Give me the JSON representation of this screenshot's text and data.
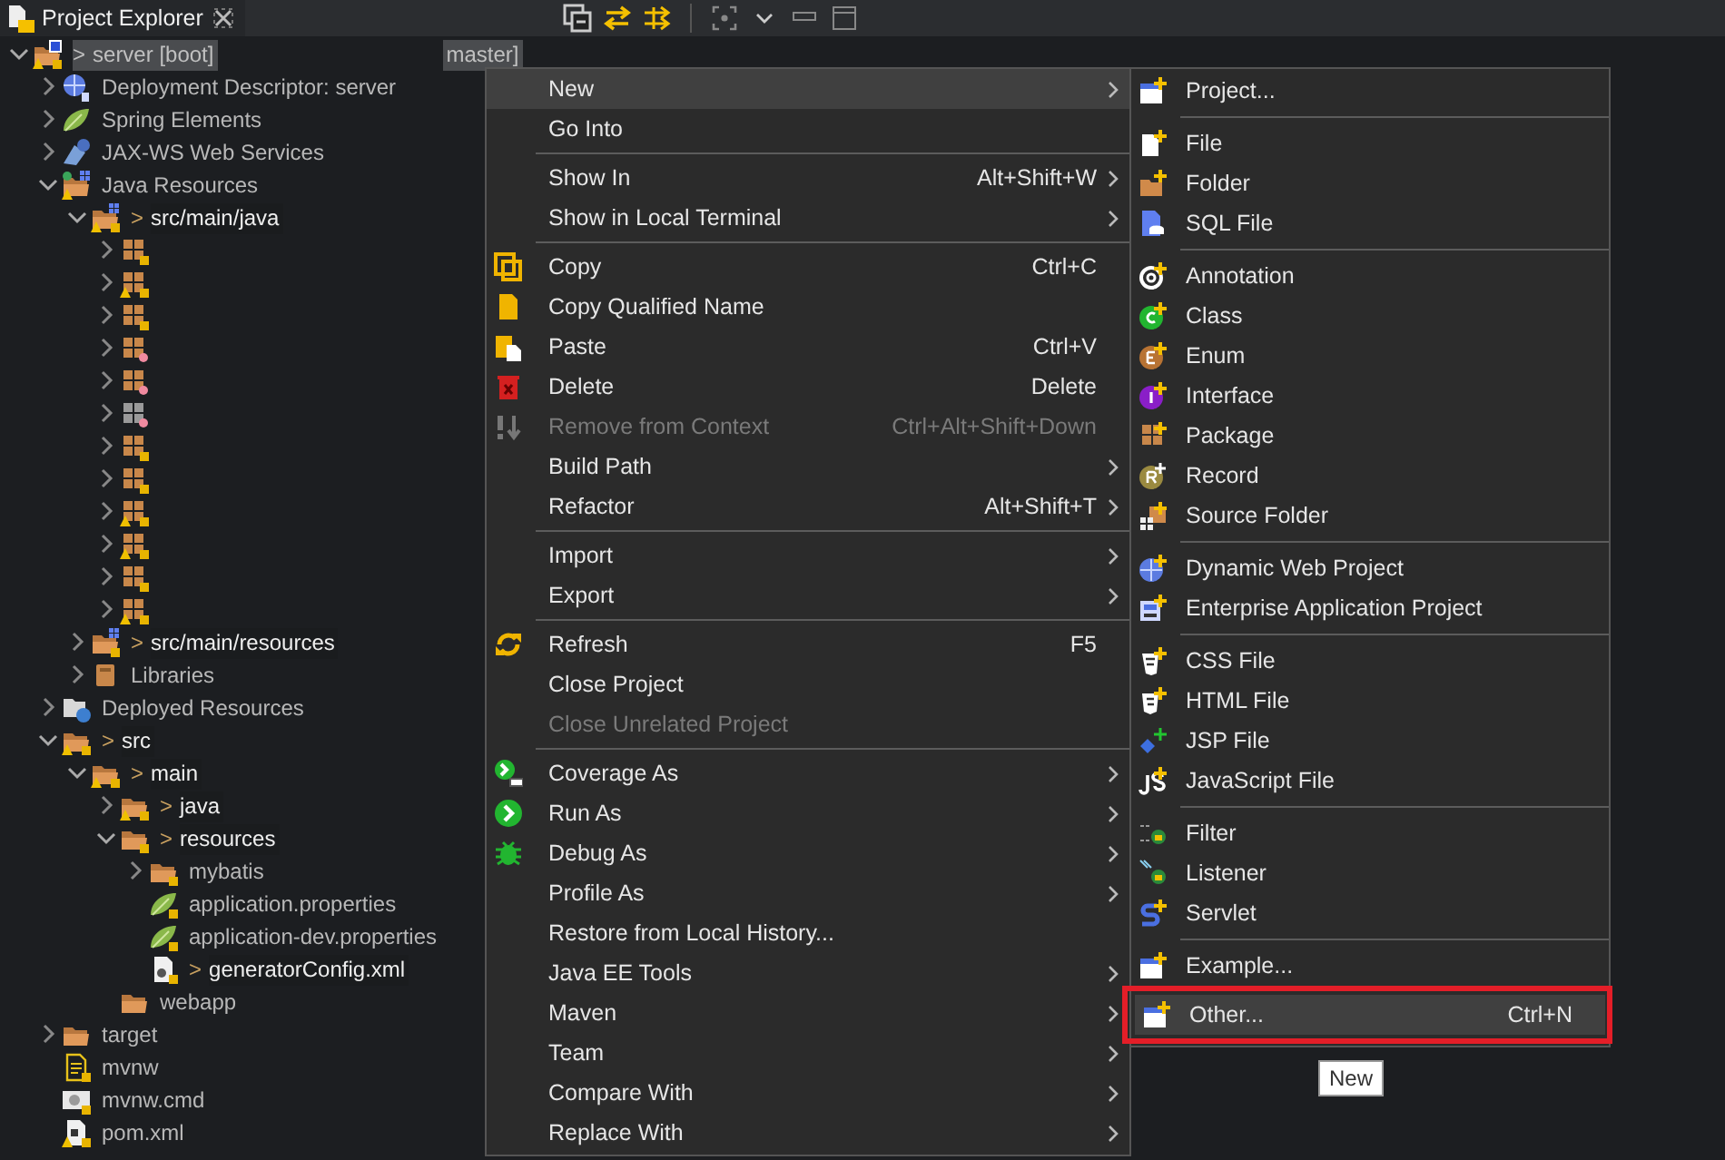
{
  "tab": {
    "title": "Project Explorer"
  },
  "tree": [
    {
      "label": "server [boot]",
      "prefix": ">",
      "tail": "master]",
      "kind": "project",
      "warning": true,
      "selected": true,
      "expanded": true,
      "children": [
        {
          "label": "Deployment Descriptor: server",
          "kind": "descriptor",
          "warning": false,
          "selected": false,
          "expanded": false
        },
        {
          "label": "Spring Elements",
          "kind": "spring",
          "warning": false,
          "selected": false,
          "expanded": false
        },
        {
          "label": "JAX-WS Web Services",
          "kind": "webservices",
          "warning": false,
          "selected": false,
          "expanded": false
        },
        {
          "label": "Java Resources",
          "kind": "java-resources",
          "warning": true,
          "selected": false,
          "expanded": true,
          "children": [
            {
              "label": "src/main/java",
              "prefix": ">",
              "kind": "source-folder",
              "warning": true,
              "selected": false,
              "expanded": true,
              "children": [
                {
                  "kind": "package",
                  "warning": false,
                  "selected": false,
                  "expanded": false
                },
                {
                  "kind": "package",
                  "warning": true,
                  "selected": false,
                  "expanded": false
                },
                {
                  "kind": "package",
                  "warning": false,
                  "selected": false,
                  "expanded": false
                },
                {
                  "kind": "package-q",
                  "warning": false,
                  "selected": false,
                  "expanded": false
                },
                {
                  "kind": "package-q",
                  "warning": false,
                  "selected": false,
                  "expanded": false
                },
                {
                  "kind": "package-grey",
                  "warning": false,
                  "selected": false,
                  "expanded": false
                },
                {
                  "kind": "package",
                  "warning": false,
                  "selected": false,
                  "expanded": false
                },
                {
                  "kind": "package",
                  "warning": false,
                  "selected": false,
                  "expanded": false
                },
                {
                  "kind": "package",
                  "warning": true,
                  "selected": false,
                  "expanded": false
                },
                {
                  "kind": "package",
                  "warning": true,
                  "selected": false,
                  "expanded": false
                },
                {
                  "kind": "package",
                  "warning": false,
                  "selected": false,
                  "expanded": false
                },
                {
                  "kind": "package",
                  "warning": true,
                  "selected": false,
                  "expanded": false
                }
              ]
            },
            {
              "label": "src/main/resources",
              "prefix": ">",
              "kind": "source-folder",
              "warning": false,
              "selected": false,
              "expanded": false
            },
            {
              "label": "Libraries",
              "kind": "libraries",
              "warning": false,
              "selected": false,
              "expanded": false
            }
          ]
        },
        {
          "label": "Deployed Resources",
          "kind": "deployed",
          "warning": false,
          "selected": false,
          "expanded": false
        },
        {
          "label": "src",
          "prefix": ">",
          "kind": "boot-folder",
          "warning": true,
          "selected": false,
          "expanded": true,
          "children": [
            {
              "label": "main",
              "prefix": ">",
              "kind": "boot-folder",
              "warning": true,
              "selected": false,
              "expanded": true,
              "children": [
                {
                  "label": "java",
                  "prefix": ">",
                  "kind": "boot-folder",
                  "warning": true,
                  "selected": false,
                  "expanded": false
                },
                {
                  "label": "resources",
                  "prefix": ">",
                  "kind": "boot-folder",
                  "warning": false,
                  "selected": false,
                  "expanded": true,
                  "children": [
                    {
                      "label": "mybatis",
                      "kind": "boot-folder",
                      "warning": false,
                      "selected": false,
                      "expanded": false
                    },
                    {
                      "label": "application.properties",
                      "kind": "props",
                      "warning": false,
                      "selected": false
                    },
                    {
                      "label": "application-dev.properties",
                      "kind": "props",
                      "warning": false,
                      "selected": false
                    },
                    {
                      "label": "generatorConfig.xml",
                      "prefix": ">",
                      "kind": "xml",
                      "warning": false,
                      "selected": false
                    }
                  ]
                },
                {
                  "label": "webapp",
                  "kind": "folder",
                  "warning": false,
                  "selected": false
                }
              ]
            }
          ]
        },
        {
          "label": "target",
          "kind": "folder",
          "warning": false,
          "selected": false,
          "expanded": false
        },
        {
          "label": "mvnw",
          "kind": "text-file",
          "warning": false,
          "selected": false
        },
        {
          "label": "mvnw.cmd",
          "kind": "cmd",
          "warning": false,
          "selected": false
        },
        {
          "label": "pom.xml",
          "kind": "pom",
          "warning": true,
          "selected": false
        }
      ]
    }
  ],
  "context_menu": {
    "items": [
      {
        "label": "New",
        "kind": "plain",
        "has_submenu": true,
        "disabled": false,
        "selected": true
      },
      {
        "label": "Go Into",
        "kind": "plain",
        "has_submenu": false,
        "disabled": false,
        "selected": false
      },
      {
        "kind": "separator"
      },
      {
        "label": "Show In",
        "shortcut": "Alt+Shift+W",
        "kind": "plain",
        "has_submenu": true,
        "disabled": false,
        "selected": false
      },
      {
        "label": "Show in Local Terminal",
        "kind": "plain",
        "has_submenu": true,
        "disabled": false,
        "selected": false
      },
      {
        "kind": "separator"
      },
      {
        "label": "Copy",
        "shortcut": "Ctrl+C",
        "kind": "copy",
        "has_submenu": false,
        "disabled": false,
        "selected": false
      },
      {
        "label": "Copy Qualified Name",
        "kind": "copy-name",
        "has_submenu": false,
        "disabled": false,
        "selected": false
      },
      {
        "label": "Paste",
        "shortcut": "Ctrl+V",
        "kind": "paste",
        "has_submenu": false,
        "disabled": false,
        "selected": false
      },
      {
        "label": "Delete",
        "shortcut": "Delete",
        "kind": "delete",
        "has_submenu": false,
        "disabled": false,
        "selected": false
      },
      {
        "label": "Remove from Context",
        "shortcut": "Ctrl+Alt+Shift+Down",
        "kind": "remove",
        "has_submenu": false,
        "disabled": true,
        "selected": false
      },
      {
        "label": "Build Path",
        "kind": "plain",
        "has_submenu": true,
        "disabled": false,
        "selected": false
      },
      {
        "label": "Refactor",
        "shortcut": "Alt+Shift+T",
        "kind": "plain",
        "has_submenu": true,
        "disabled": false,
        "selected": false
      },
      {
        "kind": "separator"
      },
      {
        "label": "Import",
        "kind": "plain",
        "has_submenu": true,
        "disabled": false,
        "selected": false
      },
      {
        "label": "Export",
        "kind": "plain",
        "has_submenu": true,
        "disabled": false,
        "selected": false
      },
      {
        "kind": "separator"
      },
      {
        "label": "Refresh",
        "shortcut": "F5",
        "kind": "refresh",
        "has_submenu": false,
        "disabled": false,
        "selected": false
      },
      {
        "label": "Close Project",
        "kind": "plain",
        "has_submenu": false,
        "disabled": false,
        "selected": false
      },
      {
        "label": "Close Unrelated Project",
        "kind": "plain",
        "has_submenu": false,
        "disabled": true,
        "selected": false
      },
      {
        "kind": "separator"
      },
      {
        "label": "Coverage As",
        "kind": "coverage",
        "has_submenu": true,
        "disabled": false,
        "selected": false
      },
      {
        "label": "Run As",
        "kind": "run",
        "has_submenu": true,
        "disabled": false,
        "selected": false
      },
      {
        "label": "Debug As",
        "kind": "debug",
        "has_submenu": true,
        "disabled": false,
        "selected": false
      },
      {
        "label": "Profile As",
        "kind": "plain",
        "has_submenu": true,
        "disabled": false,
        "selected": false
      },
      {
        "label": "Restore from Local History...",
        "kind": "plain",
        "has_submenu": false,
        "disabled": false,
        "selected": false
      },
      {
        "label": "Java EE Tools",
        "kind": "plain",
        "has_submenu": true,
        "disabled": false,
        "selected": false
      },
      {
        "label": "Maven",
        "kind": "plain",
        "has_submenu": true,
        "disabled": false,
        "selected": false
      },
      {
        "label": "Team",
        "kind": "plain",
        "has_submenu": true,
        "disabled": false,
        "selected": false
      },
      {
        "label": "Compare With",
        "kind": "plain",
        "has_submenu": true,
        "disabled": false,
        "selected": false
      },
      {
        "label": "Replace With",
        "kind": "plain",
        "has_submenu": true,
        "disabled": false,
        "selected": false
      }
    ]
  },
  "submenu": {
    "items": [
      {
        "label": "Project...",
        "kind": "new-project",
        "selected": false,
        "highlighted": false
      },
      {
        "kind": "separator"
      },
      {
        "label": "File",
        "kind": "new-file",
        "selected": false,
        "highlighted": false
      },
      {
        "label": "Folder",
        "kind": "new-folder",
        "selected": false,
        "highlighted": false
      },
      {
        "label": "SQL File",
        "kind": "sql",
        "selected": false,
        "highlighted": false
      },
      {
        "kind": "separator"
      },
      {
        "label": "Annotation",
        "kind": "annotation",
        "selected": false,
        "highlighted": false
      },
      {
        "label": "Class",
        "kind": "class",
        "selected": false,
        "highlighted": false
      },
      {
        "label": "Enum",
        "kind": "enum",
        "selected": false,
        "highlighted": false
      },
      {
        "label": "Interface",
        "kind": "interface",
        "selected": false,
        "highlighted": false
      },
      {
        "label": "Package",
        "kind": "package",
        "selected": false,
        "highlighted": false
      },
      {
        "label": "Record",
        "kind": "record",
        "selected": false,
        "highlighted": false
      },
      {
        "label": "Source Folder",
        "kind": "source-folder",
        "selected": false,
        "highlighted": false
      },
      {
        "kind": "separator"
      },
      {
        "label": "Dynamic Web Project",
        "kind": "web-project",
        "selected": false,
        "highlighted": false
      },
      {
        "label": "Enterprise Application Project",
        "kind": "enterprise",
        "selected": false,
        "highlighted": false
      },
      {
        "kind": "separator"
      },
      {
        "label": "CSS File",
        "kind": "css",
        "selected": false,
        "highlighted": false
      },
      {
        "label": "HTML File",
        "kind": "html",
        "selected": false,
        "highlighted": false
      },
      {
        "label": "JSP File",
        "kind": "jsp",
        "selected": false,
        "highlighted": false
      },
      {
        "label": "JavaScript File",
        "kind": "js",
        "selected": false,
        "highlighted": false
      },
      {
        "kind": "separator"
      },
      {
        "label": "Filter",
        "kind": "filter",
        "selected": false,
        "highlighted": false
      },
      {
        "label": "Listener",
        "kind": "listener",
        "selected": false,
        "highlighted": false
      },
      {
        "label": "Servlet",
        "kind": "servlet",
        "selected": false,
        "highlighted": false
      },
      {
        "kind": "separator"
      },
      {
        "label": "Example...",
        "kind": "new-project",
        "selected": false,
        "highlighted": false
      },
      {
        "label": "Other...",
        "shortcut": "Ctrl+N",
        "kind": "new-project",
        "selected": true,
        "highlighted": true
      }
    ]
  },
  "tooltip": {
    "text": "New"
  }
}
